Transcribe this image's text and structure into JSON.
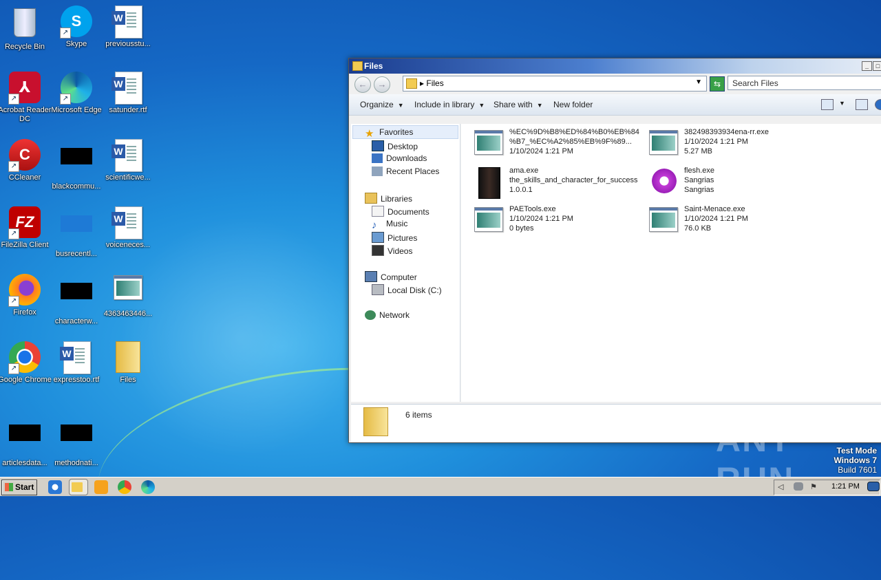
{
  "desktop": {
    "icons": [
      {
        "label": "Recycle Bin"
      },
      {
        "label": "Skype"
      },
      {
        "label": "previousstu..."
      },
      {
        "label": "Acrobat Reader DC"
      },
      {
        "label": "Microsoft Edge"
      },
      {
        "label": "satunder.rtf"
      },
      {
        "label": "CCleaner"
      },
      {
        "label": "blackcommu..."
      },
      {
        "label": "scientificwe..."
      },
      {
        "label": "FileZilla Client"
      },
      {
        "label": "busrecentl..."
      },
      {
        "label": "voiceneces..."
      },
      {
        "label": "Firefox"
      },
      {
        "label": "characterw..."
      },
      {
        "label": "4363463446..."
      },
      {
        "label": "Google Chrome"
      },
      {
        "label": "expresstoo.rtf"
      },
      {
        "label": "Files"
      },
      {
        "label": "articlesdata..."
      },
      {
        "label": "methodnati..."
      }
    ]
  },
  "window": {
    "title": "Files",
    "address_crumb": "Files",
    "search_placeholder": "Search Files",
    "toolbar": {
      "organize": "Organize",
      "include_in_library": "Include in library",
      "share_with": "Share with",
      "new_folder": "New folder"
    },
    "nav": {
      "favorites": "Favorites",
      "desktop": "Desktop",
      "downloads": "Downloads",
      "recent_places": "Recent Places",
      "libraries": "Libraries",
      "documents": "Documents",
      "music": "Music",
      "pictures": "Pictures",
      "videos": "Videos",
      "computer": "Computer",
      "local_disk": "Local Disk (C:)",
      "network": "Network"
    },
    "files": [
      {
        "name": "%EC%9D%B8%ED%84%B0%EB%84%B7_%EC%A2%85%EB%9F%89...",
        "line1": "%EC%9D%B8%ED%84%B0%EB%84",
        "line2": "%B7_%EC%A2%85%EB%9F%89...",
        "line3": "1/10/2024 1:21 PM"
      },
      {
        "name": "382498393934ena-rr.exe",
        "line1": "382498393934ena-rr.exe",
        "line2": "1/10/2024 1:21 PM",
        "line3": "5.27 MB"
      },
      {
        "name": "ama.exe",
        "line1": "ama.exe",
        "line2": "the_skills_and_character_for_success",
        "line3": "1.0.0.1"
      },
      {
        "name": "flesh.exe",
        "line1": "flesh.exe",
        "line2": "Sangrias",
        "line3": "Sangrias"
      },
      {
        "name": "PAETools.exe",
        "line1": "PAETools.exe",
        "line2": "1/10/2024 1:21 PM",
        "line3": "0 bytes"
      },
      {
        "name": "Saint-Menace.exe",
        "line1": "Saint-Menace.exe",
        "line2": "1/10/2024 1:21 PM",
        "line3": "76.0 KB"
      }
    ],
    "status": "6 items"
  },
  "taskbar": {
    "start": "Start",
    "clock": "1:21 PM"
  },
  "watermark": "ANY RUN",
  "testmode": {
    "line1": "Test Mode",
    "line2": "Windows 7",
    "line3": "Build 7601"
  }
}
